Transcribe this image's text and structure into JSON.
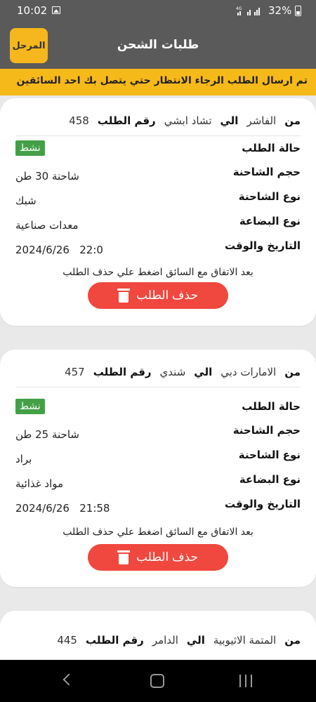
{
  "status_bar": {
    "time": "10:02",
    "network": "4G",
    "battery": "32%"
  },
  "app_bar": {
    "title": "طلبات الشحن",
    "logo_main": "المرحل",
    "logo_accent": "ل"
  },
  "banner": {
    "text": "تم ارسال الطلب الرجاء الانتظار حتي يتصل بك احد السائقين"
  },
  "labels": {
    "from": "من",
    "to": "الي",
    "order_number": "رقم الطلب",
    "status": "حالة الطلب",
    "truck_size": "حجم الشاحنة",
    "truck_type": "نوع الشاحنة",
    "cargo_type": "نوع البضاعة",
    "datetime": "التاريخ والوقت"
  },
  "orders": [
    {
      "from": "الفاشر",
      "to": "تشاد ابشي",
      "number": "458",
      "status": "نشط",
      "truck_size": "شاحنة 30 طن",
      "truck_type": "شبك",
      "cargo": "معدات صناعية",
      "date": "2024/6/26",
      "time": "22:0",
      "note": "بعد الاتفاق مع السائق اضغط علي حذف الطلب",
      "delete_label": "حذف الطلب"
    },
    {
      "from": "الامارات دبي",
      "to": "شندي",
      "number": "457",
      "status": "نشط",
      "truck_size": "شاحنة 25 طن",
      "truck_type": "براد",
      "cargo": "مواد غذائية",
      "date": "2024/6/26",
      "time": "21:58",
      "note": "بعد الاتفاق مع السائق اضغط علي حذف الطلب",
      "delete_label": "حذف الطلب"
    },
    {
      "from": "المتمة الاثيوبية",
      "to": "الدامر",
      "number": "445"
    }
  ],
  "colors": {
    "accent": "#f6b91a",
    "bar": "#5a5a5a",
    "active": "#43a047",
    "delete": "#f0473e"
  },
  "icons": [
    "image-icon",
    "signal-icon",
    "battery-icon",
    "trash-icon",
    "back-icon",
    "home-icon",
    "recents-icon"
  ]
}
